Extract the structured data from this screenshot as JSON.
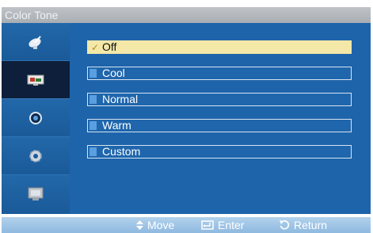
{
  "title": "Color Tone",
  "sidebar": {
    "items": [
      {
        "icon": "satellite-dish-icon"
      },
      {
        "icon": "picture-icon",
        "active": true
      },
      {
        "icon": "sound-icon"
      },
      {
        "icon": "gear-icon"
      },
      {
        "icon": "monitor-icon"
      }
    ]
  },
  "options": [
    {
      "label": "Off",
      "selected": true
    },
    {
      "label": "Cool"
    },
    {
      "label": "Normal"
    },
    {
      "label": "Warm"
    },
    {
      "label": "Custom"
    }
  ],
  "footer": {
    "move": "Move",
    "enter": "Enter",
    "return": "Return"
  },
  "colors": {
    "panel": "#1a5fa3",
    "selected": "#f3e8a8",
    "title_bar": "#b5b9be",
    "footer_bar": "#9ec3e6"
  }
}
